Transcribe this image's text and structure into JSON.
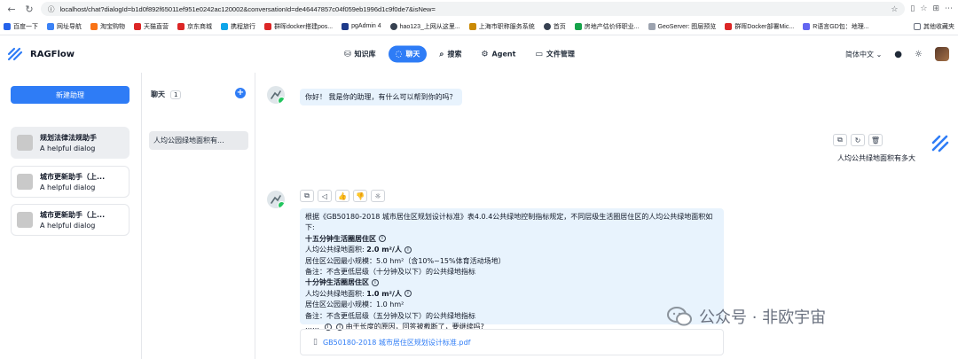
{
  "browser": {
    "url": "localhost/chat?dialogId=b1d0f892f65011ef951e0242ac120002&conversationId=de46447857c04f059eb1996d1c9f0de7&isNew=",
    "bookmarks": [
      "百度一下",
      "网址导航",
      "淘宝购物",
      "天猫直营",
      "京东商城",
      "携程旅行",
      "群晖docker搭建pos...",
      "pgAdmin 4",
      "hao123_上网从这里...",
      "上海市职称服务系统",
      "首页",
      "房地产估价师职业...",
      "GeoServer: 图层预览",
      "群晖Docker部署Mic...",
      "R语言GD包：地理...",
      "其他收藏夹"
    ]
  },
  "app": {
    "name": "RAGFlow",
    "nav": [
      {
        "label": "知识库",
        "icon": "database-icon"
      },
      {
        "label": "聊天",
        "icon": "chat-icon"
      },
      {
        "label": "搜索",
        "icon": "search-icon"
      },
      {
        "label": "Agent",
        "icon": "agent-icon"
      },
      {
        "label": "文件管理",
        "icon": "folder-icon"
      }
    ],
    "language": "简体中文"
  },
  "sidebar": {
    "new_button": "新建助理",
    "assistants": [
      {
        "name": "规划法律法规助手",
        "desc": "A helpful dialog"
      },
      {
        "name": "城市更新助手（上...",
        "desc": "A helpful dialog"
      },
      {
        "name": "城市更新助手（上...",
        "desc": "A helpful dialog"
      }
    ]
  },
  "conversations": {
    "title": "聊天",
    "count": "1",
    "items": [
      "人均公园绿地面积有..."
    ]
  },
  "chat": {
    "greeting": "你好！ 我是你的助理，有什么可以帮到你的吗？",
    "user_question": "人均公共绿地面积有多大",
    "answer": {
      "intro": "根据《GB50180-2018 城市居住区规划设计标准》表4.0.4公共绿地控制指标规定，不同层级生活圈居住区的人均公共绿地面积如下:",
      "s1_title": "十五分钟生活圈居住区",
      "s1_l1_prefix": "人均公共绿地面积:",
      "s1_l1_value": "2.0 m²/人",
      "s1_l2": "居住区公园最小规模：5.0 hm²（含10%~15%体育活动场地）",
      "s1_l3": "备注：不含更低层级（十分钟及以下）的公共绿地指标",
      "s2_title": "十分钟生活圈居住区",
      "s2_l1_prefix": "人均公共绿地面积:",
      "s2_l1_value": "1.0 m²/人",
      "s2_l2": "居住区公园最小规模：1.0 hm²",
      "s2_l3": "备注：不含更低层级（五分钟及以下）的公共绿地指标",
      "truncated_prefix": "……",
      "truncated": "由于长度的原因，回答被截断了，要继续吗?"
    },
    "reference_file": "GB50180-2018 城市居住区规划设计标准.pdf"
  },
  "watermark": "公众号 · 非欧宇宙",
  "colors": {
    "accent": "#2e7cf6",
    "bubble": "#e8f3fd",
    "online": "#22c55e"
  }
}
